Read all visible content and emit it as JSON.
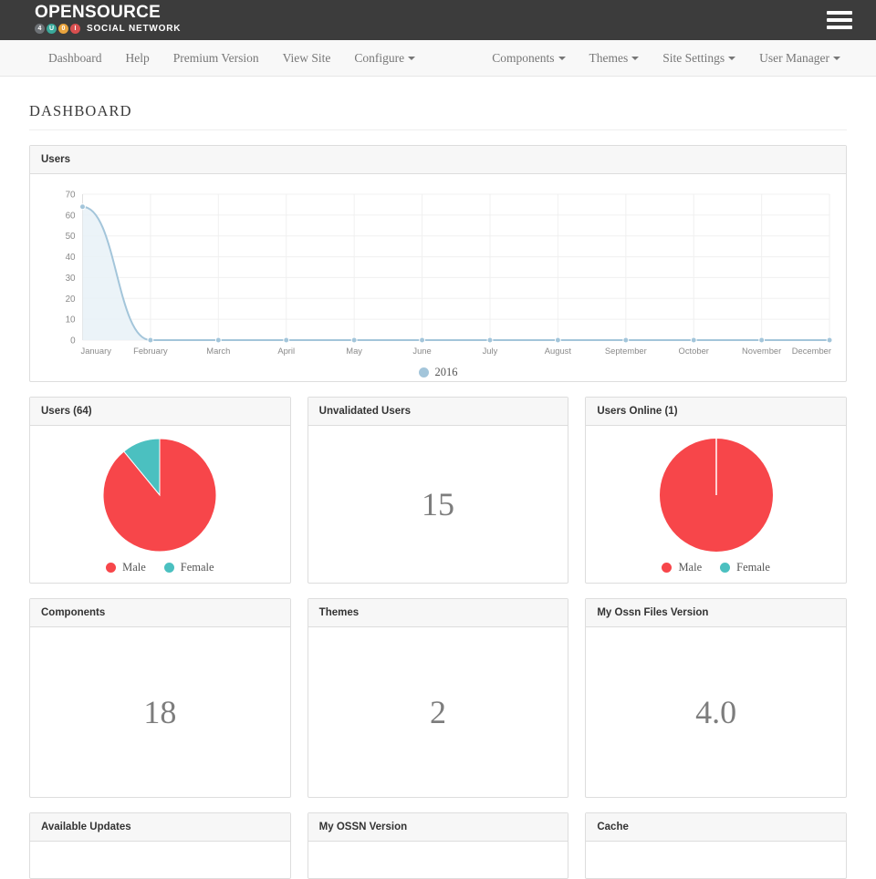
{
  "brand": {
    "name": "OPENSOURCE",
    "tagline": "SOCIAL NETWORK",
    "badges": [
      {
        "letter": "4",
        "color": "#6d7175"
      },
      {
        "letter": "U",
        "color": "#3aa99a"
      },
      {
        "letter": "0",
        "color": "#e8a33d"
      },
      {
        "letter": "I",
        "color": "#d94f4f"
      }
    ],
    "menu_icon": "hamburger-icon"
  },
  "nav": {
    "left": [
      {
        "label": "Dashboard",
        "caret": false
      },
      {
        "label": "Help",
        "caret": false
      },
      {
        "label": "Premium Version",
        "caret": false
      },
      {
        "label": "View Site",
        "caret": false
      },
      {
        "label": "Configure",
        "caret": true
      }
    ],
    "right": [
      {
        "label": "Components",
        "caret": true
      },
      {
        "label": "Themes",
        "caret": true
      },
      {
        "label": "Site Settings",
        "caret": true
      },
      {
        "label": "User Manager",
        "caret": true
      }
    ]
  },
  "page": {
    "title": "DASHBOARD"
  },
  "colors": {
    "header_bg": "#3c3c3c",
    "nav_bg": "#f8f8f8",
    "male": "#f7464a",
    "female": "#4bc0c0",
    "line": "#a3c5da",
    "line_fill": "#e8f1f7"
  },
  "panels": {
    "users_chart": {
      "title": "Users"
    },
    "users_pie": {
      "title": "Users (64)"
    },
    "unvalidated": {
      "title": "Unvalidated Users",
      "value": "15"
    },
    "users_online": {
      "title": "Users Online (1)"
    },
    "components": {
      "title": "Components",
      "value": "18"
    },
    "themes": {
      "title": "Themes",
      "value": "2"
    },
    "files_version": {
      "title": "My Ossn Files Version",
      "value": "4.0"
    },
    "available_updates": {
      "title": "Available Updates"
    },
    "ossn_version": {
      "title": "My OSSN Version"
    },
    "cache": {
      "title": "Cache"
    }
  },
  "chart_data": [
    {
      "type": "line",
      "title": "Users",
      "xlabel": "",
      "ylabel": "",
      "categories": [
        "January",
        "February",
        "March",
        "April",
        "May",
        "June",
        "July",
        "August",
        "September",
        "October",
        "November",
        "December"
      ],
      "series": [
        {
          "name": "2016",
          "color": "#a3c5da",
          "values": [
            64,
            0,
            0,
            0,
            0,
            0,
            0,
            0,
            0,
            0,
            0,
            0
          ]
        }
      ],
      "yticks": [
        0,
        10,
        20,
        30,
        40,
        50,
        60,
        70
      ],
      "ylim": [
        0,
        70
      ],
      "grid": true,
      "legend": [
        "2016"
      ],
      "legend_position": "bottom",
      "fill": true
    },
    {
      "type": "pie",
      "title": "Users (64)",
      "labels": [
        "Male",
        "Female"
      ],
      "values": [
        57,
        7
      ],
      "percentages": [
        89.1,
        10.9
      ],
      "colors": [
        "#f7464a",
        "#4bc0c0"
      ],
      "legend_position": "bottom"
    },
    {
      "type": "pie",
      "title": "Users Online (1)",
      "labels": [
        "Male",
        "Female"
      ],
      "values": [
        1,
        0
      ],
      "percentages": [
        100,
        0
      ],
      "colors": [
        "#f7464a",
        "#4bc0c0"
      ],
      "legend_position": "bottom"
    }
  ],
  "legend_labels": {
    "male": "Male",
    "female": "Female",
    "year": "2016"
  }
}
